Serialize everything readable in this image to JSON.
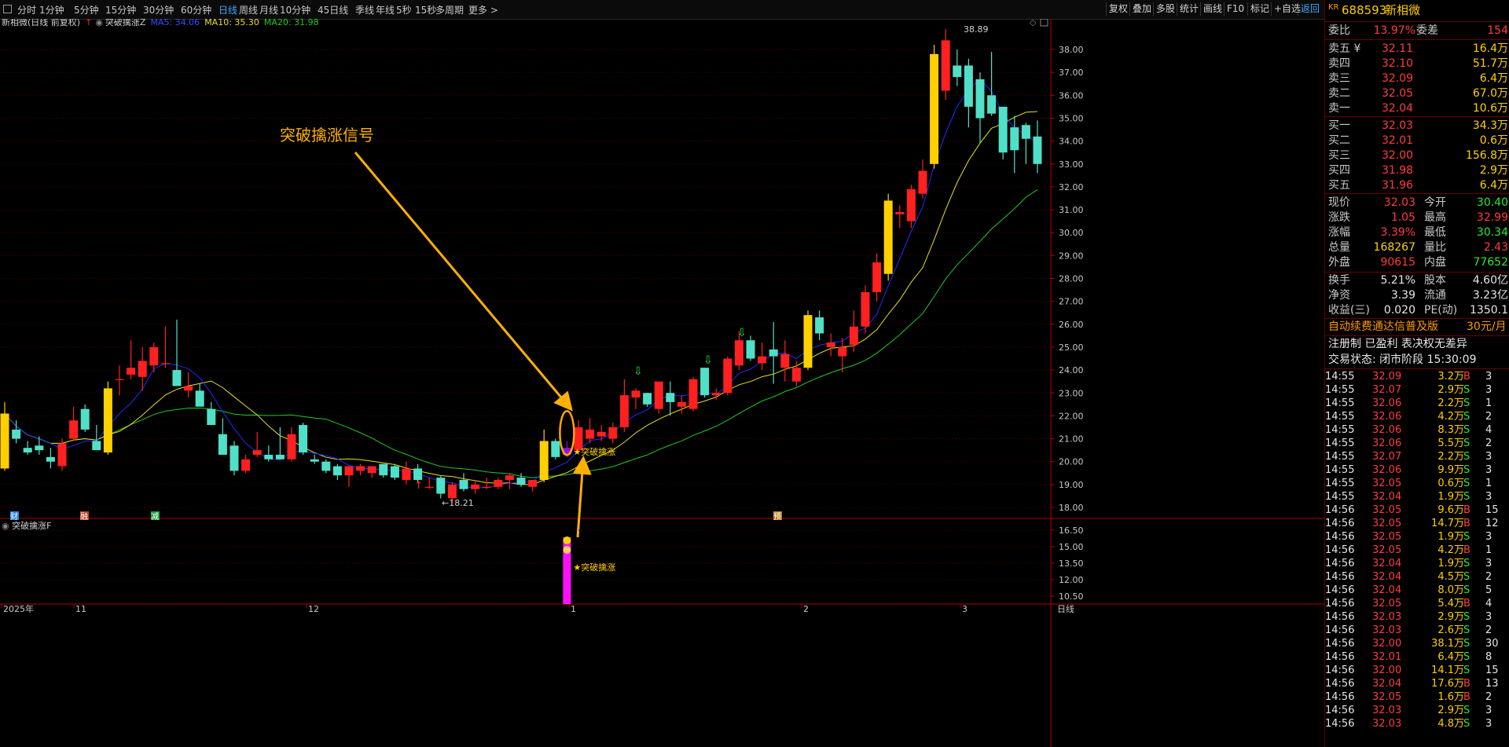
{
  "toolbar": {
    "periods": [
      "分时",
      "1分钟",
      "5分钟",
      "15分钟",
      "30分钟",
      "60分钟",
      "日线",
      "周线",
      "月线",
      "10分钟",
      "45日线",
      "季线",
      "年线",
      "5秒",
      "15秒",
      "多周期",
      "更多 >"
    ],
    "active_period": "日线",
    "right_buttons": [
      "复权",
      "叠加",
      "多股",
      "统计",
      "画线",
      "F10",
      "标记",
      "+自选",
      "返回"
    ]
  },
  "chart_header": {
    "stock_label": "新相微(日线 前复权)",
    "indicator_name": "突破擒涨Z",
    "ma5": "MA5: 34.06",
    "ma10": "MA10: 35.30",
    "ma20": "MA20: 31.98"
  },
  "colors": {
    "up": "#ff2020",
    "down": "#50e0c8",
    "ma5": "#1c2cff",
    "ma10": "#e8e020",
    "ma20": "#20c820",
    "highlight": "#9010f0",
    "annotation": "#ffb000",
    "bg": "#000000"
  },
  "annotation": {
    "text": "突破擒涨信号",
    "signal_label": "突破擒涨"
  },
  "markers": {
    "low_label": "←18.21",
    "high_label": "38.89",
    "event_tags": [
      "财",
      "融",
      "减",
      "预"
    ]
  },
  "sub_panel": {
    "name": "突破擒涨F",
    "signal_label": "突破擒涨",
    "ticks": [
      "16.50",
      "15.00",
      "13.50",
      "12.00",
      "10.50"
    ]
  },
  "time_axis": {
    "labels": [
      "2025年",
      "11",
      "12",
      "1",
      "2",
      "3"
    ],
    "right_label": "日线"
  },
  "price_ticks": [
    "38.00",
    "37.00",
    "36.00",
    "35.00",
    "34.00",
    "33.00",
    "32.00",
    "31.00",
    "30.00",
    "29.00",
    "28.00",
    "27.00",
    "26.00",
    "25.00",
    "24.00",
    "23.00",
    "22.00",
    "21.00",
    "20.00",
    "19.00",
    "18.00"
  ],
  "chart_data": {
    "type": "candlestick",
    "title": "新相微(日线 前复权)",
    "ylim": [
      17.6,
      39.4
    ],
    "candles": [
      {
        "o": 19.7,
        "h": 22.6,
        "l": 19.6,
        "c": 22.1
      },
      {
        "o": 21.4,
        "h": 21.8,
        "l": 20.8,
        "c": 21.0
      },
      {
        "o": 20.6,
        "h": 20.9,
        "l": 20.3,
        "c": 20.4
      },
      {
        "o": 20.7,
        "h": 21.1,
        "l": 20.3,
        "c": 20.5
      },
      {
        "o": 20.2,
        "h": 20.6,
        "l": 19.7,
        "c": 20.0
      },
      {
        "o": 19.8,
        "h": 21.0,
        "l": 19.6,
        "c": 20.8
      },
      {
        "o": 21.0,
        "h": 22.4,
        "l": 20.9,
        "c": 21.8
      },
      {
        "o": 22.3,
        "h": 22.5,
        "l": 21.3,
        "c": 21.4
      },
      {
        "o": 20.9,
        "h": 21.6,
        "l": 20.7,
        "c": 20.5
      },
      {
        "o": 20.4,
        "h": 23.5,
        "l": 20.3,
        "c": 23.2
      },
      {
        "o": 23.6,
        "h": 24.2,
        "l": 22.9,
        "c": 23.6
      },
      {
        "o": 23.8,
        "h": 25.3,
        "l": 23.6,
        "c": 24.1
      },
      {
        "o": 23.7,
        "h": 25.0,
        "l": 23.1,
        "c": 24.4
      },
      {
        "o": 24.2,
        "h": 25.2,
        "l": 23.9,
        "c": 25.0
      },
      {
        "o": 24.3,
        "h": 25.9,
        "l": 24.1,
        "c": 24.3
      },
      {
        "o": 24.0,
        "h": 26.2,
        "l": 23.8,
        "c": 23.3
      },
      {
        "o": 23.1,
        "h": 23.9,
        "l": 22.8,
        "c": 23.3
      },
      {
        "o": 23.1,
        "h": 23.4,
        "l": 22.5,
        "c": 22.4
      },
      {
        "o": 22.3,
        "h": 22.6,
        "l": 21.6,
        "c": 21.6
      },
      {
        "o": 21.2,
        "h": 21.9,
        "l": 20.7,
        "c": 20.3
      },
      {
        "o": 20.7,
        "h": 20.9,
        "l": 19.4,
        "c": 19.6
      },
      {
        "o": 19.6,
        "h": 20.3,
        "l": 19.5,
        "c": 20.1
      },
      {
        "o": 20.3,
        "h": 21.3,
        "l": 20.2,
        "c": 20.5
      },
      {
        "o": 20.3,
        "h": 20.7,
        "l": 20.0,
        "c": 20.1
      },
      {
        "o": 20.3,
        "h": 21.5,
        "l": 20.1,
        "c": 20.1
      },
      {
        "o": 20.1,
        "h": 21.5,
        "l": 20.0,
        "c": 21.2
      },
      {
        "o": 21.6,
        "h": 21.7,
        "l": 20.3,
        "c": 20.4
      },
      {
        "o": 20.1,
        "h": 20.3,
        "l": 19.9,
        "c": 20.0
      },
      {
        "o": 20.0,
        "h": 20.1,
        "l": 19.5,
        "c": 19.6
      },
      {
        "o": 19.8,
        "h": 19.9,
        "l": 19.2,
        "c": 19.4
      },
      {
        "o": 19.4,
        "h": 19.8,
        "l": 18.9,
        "c": 19.8
      },
      {
        "o": 19.6,
        "h": 19.9,
        "l": 19.4,
        "c": 19.8
      },
      {
        "o": 19.5,
        "h": 19.8,
        "l": 19.3,
        "c": 19.8
      },
      {
        "o": 19.9,
        "h": 19.9,
        "l": 19.3,
        "c": 19.4
      },
      {
        "o": 19.8,
        "h": 19.9,
        "l": 19.2,
        "c": 19.3
      },
      {
        "o": 19.2,
        "h": 20.0,
        "l": 19.0,
        "c": 19.7
      },
      {
        "o": 19.7,
        "h": 19.9,
        "l": 19.1,
        "c": 19.2
      },
      {
        "o": 18.9,
        "h": 19.3,
        "l": 18.8,
        "c": 18.9
      },
      {
        "o": 19.3,
        "h": 19.4,
        "l": 18.4,
        "c": 18.6
      },
      {
        "o": 18.4,
        "h": 19.1,
        "l": 18.2,
        "c": 19.0
      },
      {
        "o": 19.2,
        "h": 19.5,
        "l": 18.7,
        "c": 18.8
      },
      {
        "o": 18.8,
        "h": 19.2,
        "l": 18.6,
        "c": 19.0
      },
      {
        "o": 18.9,
        "h": 19.3,
        "l": 18.8,
        "c": 18.9
      },
      {
        "o": 18.9,
        "h": 19.3,
        "l": 18.8,
        "c": 19.2
      },
      {
        "o": 19.2,
        "h": 19.5,
        "l": 18.8,
        "c": 19.4
      },
      {
        "o": 19.3,
        "h": 19.5,
        "l": 18.9,
        "c": 19.0
      },
      {
        "o": 18.9,
        "h": 19.2,
        "l": 18.7,
        "c": 19.2
      },
      {
        "o": 19.2,
        "h": 21.4,
        "l": 19.1,
        "c": 20.9
      },
      {
        "o": 20.9,
        "h": 21.0,
        "l": 20.1,
        "c": 20.2
      },
      {
        "o": 20.3,
        "h": 20.9,
        "l": 20.2,
        "c": 20.6
      },
      {
        "o": 20.5,
        "h": 21.8,
        "l": 20.4,
        "c": 21.5
      },
      {
        "o": 21.0,
        "h": 21.9,
        "l": 20.8,
        "c": 21.4
      },
      {
        "o": 21.1,
        "h": 21.6,
        "l": 20.9,
        "c": 21.3
      },
      {
        "o": 21.0,
        "h": 21.7,
        "l": 20.8,
        "c": 21.5
      },
      {
        "o": 21.5,
        "h": 23.6,
        "l": 21.3,
        "c": 22.9
      },
      {
        "o": 22.8,
        "h": 23.2,
        "l": 22.3,
        "c": 23.1
      },
      {
        "o": 23.0,
        "h": 23.0,
        "l": 22.4,
        "c": 22.5
      },
      {
        "o": 22.3,
        "h": 23.3,
        "l": 22.1,
        "c": 23.5
      },
      {
        "o": 23.0,
        "h": 23.5,
        "l": 22.0,
        "c": 22.6
      },
      {
        "o": 22.4,
        "h": 22.9,
        "l": 22.1,
        "c": 22.6
      },
      {
        "o": 22.3,
        "h": 23.7,
        "l": 22.2,
        "c": 23.6
      },
      {
        "o": 24.1,
        "h": 24.1,
        "l": 22.8,
        "c": 22.9
      },
      {
        "o": 22.9,
        "h": 23.2,
        "l": 22.7,
        "c": 23.0
      },
      {
        "o": 23.0,
        "h": 24.6,
        "l": 22.9,
        "c": 24.5
      },
      {
        "o": 24.2,
        "h": 25.7,
        "l": 24.0,
        "c": 25.3
      },
      {
        "o": 25.3,
        "h": 25.5,
        "l": 24.4,
        "c": 24.5
      },
      {
        "o": 24.3,
        "h": 25.2,
        "l": 24.0,
        "c": 24.6
      },
      {
        "o": 24.9,
        "h": 26.1,
        "l": 23.4,
        "c": 24.6
      },
      {
        "o": 24.1,
        "h": 25.3,
        "l": 23.5,
        "c": 24.7
      },
      {
        "o": 23.5,
        "h": 24.4,
        "l": 23.3,
        "c": 24.1
      },
      {
        "o": 24.1,
        "h": 26.6,
        "l": 24.0,
        "c": 26.4
      },
      {
        "o": 26.3,
        "h": 26.6,
        "l": 25.3,
        "c": 25.6
      },
      {
        "o": 25.0,
        "h": 25.6,
        "l": 24.6,
        "c": 25.2
      },
      {
        "o": 24.6,
        "h": 25.4,
        "l": 23.9,
        "c": 25.0
      },
      {
        "o": 25.1,
        "h": 26.6,
        "l": 24.8,
        "c": 25.9
      },
      {
        "o": 25.9,
        "h": 27.7,
        "l": 25.6,
        "c": 27.4
      },
      {
        "o": 27.4,
        "h": 29.1,
        "l": 27.0,
        "c": 28.7
      },
      {
        "o": 28.2,
        "h": 31.7,
        "l": 27.9,
        "c": 31.4
      },
      {
        "o": 30.8,
        "h": 31.2,
        "l": 30.2,
        "c": 30.9
      },
      {
        "o": 30.5,
        "h": 32.1,
        "l": 30.2,
        "c": 31.9
      },
      {
        "o": 31.7,
        "h": 33.2,
        "l": 31.5,
        "c": 32.7
      },
      {
        "o": 33.0,
        "h": 38.2,
        "l": 32.8,
        "c": 37.8
      },
      {
        "o": 36.2,
        "h": 38.9,
        "l": 35.8,
        "c": 38.4
      },
      {
        "o": 37.3,
        "h": 38.0,
        "l": 36.4,
        "c": 36.8
      },
      {
        "o": 37.3,
        "h": 37.6,
        "l": 34.6,
        "c": 35.5
      },
      {
        "o": 36.7,
        "h": 37.0,
        "l": 33.9,
        "c": 35.0
      },
      {
        "o": 36.0,
        "h": 37.9,
        "l": 35.1,
        "c": 35.2
      },
      {
        "o": 35.5,
        "h": 35.5,
        "l": 33.2,
        "c": 33.5
      },
      {
        "o": 34.6,
        "h": 35.1,
        "l": 32.6,
        "c": 33.6
      },
      {
        "o": 34.7,
        "h": 34.8,
        "l": 33.0,
        "c": 34.1
      },
      {
        "o": 34.2,
        "h": 34.9,
        "l": 32.6,
        "c": 33.0
      }
    ],
    "highlight_index": 49
  },
  "quote": {
    "market_tag": "KR",
    "code": "688593",
    "name": "新相微",
    "weibi_label": "委比",
    "weibi_value": "13.97%",
    "weicha_label": "委差",
    "weicha_value": "154",
    "asks": [
      {
        "label": "卖五 ¥",
        "price": "32.11",
        "vol": "16.4万"
      },
      {
        "label": "卖四",
        "price": "32.10",
        "vol": "51.7万"
      },
      {
        "label": "卖三",
        "price": "32.09",
        "vol": "6.4万"
      },
      {
        "label": "卖二",
        "price": "32.05",
        "vol": "67.0万"
      },
      {
        "label": "卖一",
        "price": "32.04",
        "vol": "10.6万"
      }
    ],
    "bids": [
      {
        "label": "买一",
        "price": "32.03",
        "vol": "34.3万"
      },
      {
        "label": "买二",
        "price": "32.01",
        "vol": "0.6万"
      },
      {
        "label": "买三",
        "price": "32.00",
        "vol": "156.8万"
      },
      {
        "label": "买四",
        "price": "31.98",
        "vol": "2.9万"
      },
      {
        "label": "买五",
        "price": "31.96",
        "vol": "6.4万"
      }
    ],
    "stats": [
      {
        "l1": "现价",
        "v1": "32.03",
        "c1": "red",
        "l2": "今开",
        "v2": "30.40",
        "c2": "green"
      },
      {
        "l1": "涨跌",
        "v1": "1.05",
        "c1": "red",
        "l2": "最高",
        "v2": "32.99",
        "c2": "red"
      },
      {
        "l1": "涨幅",
        "v1": "3.39%",
        "c1": "red",
        "l2": "最低",
        "v2": "30.34",
        "c2": "green"
      },
      {
        "l1": "总量",
        "v1": "168267",
        "c1": "yellow",
        "l2": "量比",
        "v2": "2.43",
        "c2": "red"
      },
      {
        "l1": "外盘",
        "v1": "90615",
        "c1": "red",
        "l2": "内盘",
        "v2": "77652",
        "c2": "green"
      }
    ],
    "stats2": [
      {
        "l1": "换手",
        "v1": "5.21%",
        "l2": "股本",
        "v2": "4.60亿"
      },
      {
        "l1": "净资",
        "v1": "3.39",
        "l2": "流通",
        "v2": "3.23亿"
      },
      {
        "l1": "收益(三)",
        "v1": "0.020",
        "l2": "PE(动)",
        "v2": "1350.1"
      }
    ],
    "promo": "自动续费通达信普及版",
    "promo_price": "30元/月",
    "reg_info": "注册制 已盈利 表决权无差异",
    "trade_status": "交易状态: 闭市阶段 15:30:09"
  },
  "ticks": [
    {
      "t": "14:55",
      "p": "32.09",
      "v": "3.2万",
      "d": "B",
      "n": "3"
    },
    {
      "t": "14:55",
      "p": "32.07",
      "v": "2.9万",
      "d": "S",
      "n": "3"
    },
    {
      "t": "14:55",
      "p": "32.06",
      "v": "2.2万",
      "d": "S",
      "n": "1"
    },
    {
      "t": "14:55",
      "p": "32.06",
      "v": "4.2万",
      "d": "S",
      "n": "2"
    },
    {
      "t": "14:55",
      "p": "32.06",
      "v": "8.3万",
      "d": "S",
      "n": "4"
    },
    {
      "t": "14:55",
      "p": "32.06",
      "v": "5.5万",
      "d": "S",
      "n": "2"
    },
    {
      "t": "14:55",
      "p": "32.07",
      "v": "2.2万",
      "d": "S",
      "n": "3"
    },
    {
      "t": "14:55",
      "p": "32.06",
      "v": "9.9万",
      "d": "S",
      "n": "3"
    },
    {
      "t": "14:55",
      "p": "32.05",
      "v": "0.6万",
      "d": "S",
      "n": "1"
    },
    {
      "t": "14:55",
      "p": "32.04",
      "v": "1.9万",
      "d": "S",
      "n": "3"
    },
    {
      "t": "14:56",
      "p": "32.05",
      "v": "9.6万",
      "d": "B",
      "n": "15"
    },
    {
      "t": "14:56",
      "p": "32.05",
      "v": "14.7万",
      "d": "B",
      "n": "12"
    },
    {
      "t": "14:56",
      "p": "32.05",
      "v": "1.9万",
      "d": "S",
      "n": "3"
    },
    {
      "t": "14:56",
      "p": "32.05",
      "v": "4.2万",
      "d": "B",
      "n": "1"
    },
    {
      "t": "14:56",
      "p": "32.04",
      "v": "1.9万",
      "d": "S",
      "n": "3"
    },
    {
      "t": "14:56",
      "p": "32.04",
      "v": "4.5万",
      "d": "S",
      "n": "2"
    },
    {
      "t": "14:56",
      "p": "32.04",
      "v": "8.0万",
      "d": "S",
      "n": "5"
    },
    {
      "t": "14:56",
      "p": "32.05",
      "v": "5.4万",
      "d": "B",
      "n": "4"
    },
    {
      "t": "14:56",
      "p": "32.03",
      "v": "2.9万",
      "d": "S",
      "n": "3"
    },
    {
      "t": "14:56",
      "p": "32.03",
      "v": "2.6万",
      "d": "S",
      "n": "2"
    },
    {
      "t": "14:56",
      "p": "32.00",
      "v": "38.1万",
      "d": "S",
      "n": "30"
    },
    {
      "t": "14:56",
      "p": "32.01",
      "v": "6.4万",
      "d": "S",
      "n": "8"
    },
    {
      "t": "14:56",
      "p": "32.00",
      "v": "14.1万",
      "d": "S",
      "n": "15"
    },
    {
      "t": "14:56",
      "p": "32.04",
      "v": "17.6万",
      "d": "B",
      "n": "13"
    },
    {
      "t": "14:56",
      "p": "32.05",
      "v": "1.6万",
      "d": "B",
      "n": "2"
    },
    {
      "t": "14:56",
      "p": "32.03",
      "v": "2.9万",
      "d": "S",
      "n": "3"
    },
    {
      "t": "14:56",
      "p": "32.03",
      "v": "4.8万",
      "d": "S",
      "n": "3"
    }
  ]
}
